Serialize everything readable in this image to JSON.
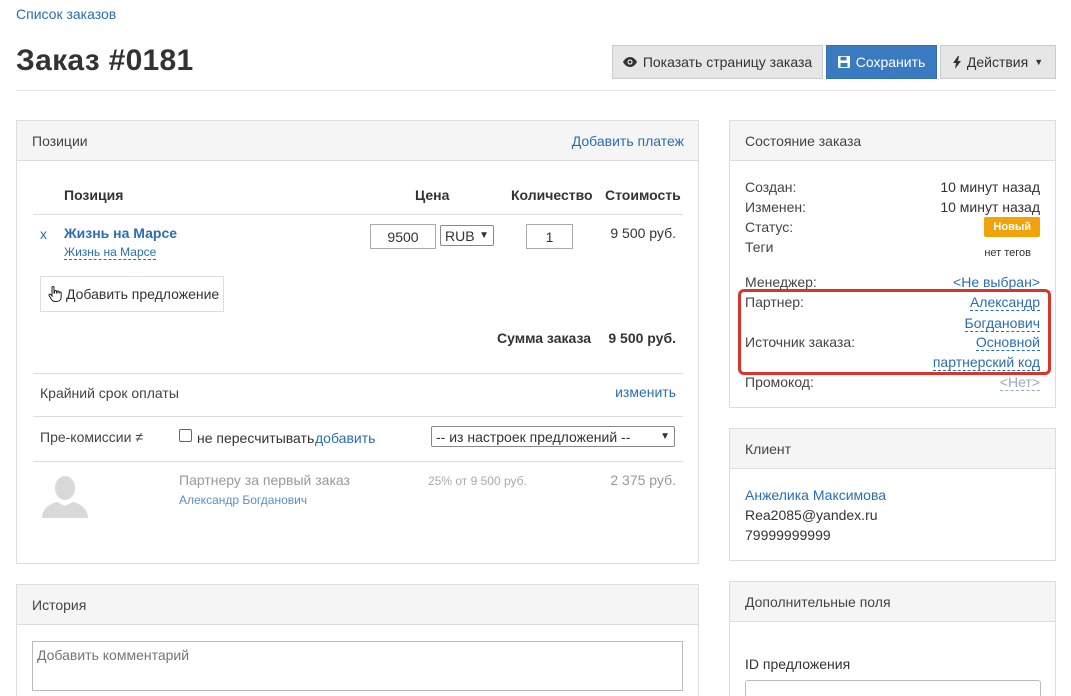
{
  "breadcrumb": "Список заказов",
  "title": "Заказ #0181",
  "toolbar": {
    "show_page": "Показать страницу заказа",
    "save": "Сохранить",
    "actions": "Действия"
  },
  "positions": {
    "title": "Позиции",
    "add_payment": "Добавить платеж",
    "columns": {
      "item": "Позиция",
      "price": "Цена",
      "qty": "Количество",
      "cost": "Стоимость"
    },
    "row": {
      "remove": "x",
      "name": "Жизнь на Марсе",
      "subname": "Жизнь на Марсе",
      "price": "9500",
      "currency": "RUB",
      "qty": "1",
      "cost": "9 500 руб."
    },
    "add_offer": "Добавить предложение",
    "total_label": "Сумма заказа",
    "total_value": "9 500 руб.",
    "deadline_label": "Крайний срок оплаты",
    "deadline_change": "изменить",
    "precomm_label": "Пре-комиссии ≠",
    "no_recalc": "не пересчитывать",
    "add": "добавить",
    "settings_select": "-- из настроек предложений --",
    "commission": {
      "title": "Партнеру за первый заказ",
      "partner": "Александр Богданович",
      "percent": "25% от 9 500 руб.",
      "amount": "2 375 руб."
    }
  },
  "history": {
    "title": "История",
    "placeholder": "Добавить комментарий"
  },
  "state": {
    "title": "Состояние заказа",
    "created_label": "Создан:",
    "created_value": "10 минут назад",
    "changed_label": "Изменен:",
    "changed_value": "10 минут назад",
    "status_label": "Статус:",
    "status_value": "Новый",
    "tags_label": "Теги",
    "tags_value": "нет тегов",
    "manager_label": "Менеджер:",
    "manager_value": "<Не выбран>",
    "partner_label": "Партнер:",
    "partner_line1": "Александр",
    "partner_line2": "Богданович",
    "source_label": "Источник заказа:",
    "source_line1": "Основной",
    "source_line2": "партнерский код",
    "promo_label": "Промокод:",
    "promo_value": "<Нет>"
  },
  "client": {
    "title": "Клиент",
    "name": "Анжелика Максимова",
    "email": "Rea2085@yandex.ru",
    "phone": "79999999999"
  },
  "extra": {
    "title": "Дополнительные поля",
    "offer_id_label": "ID предложения"
  },
  "colors": {
    "link": "#2a6db5",
    "primary": "#3a7ac0",
    "badge": "#f0a30a",
    "highlight": "#d9352b"
  }
}
